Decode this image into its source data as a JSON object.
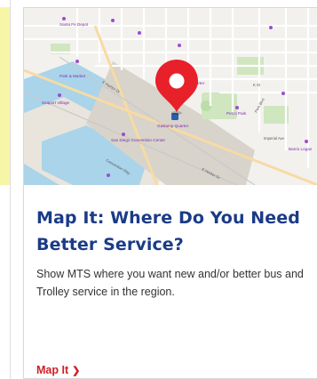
{
  "card": {
    "title": "Map It: Where Do You Need Better Service?",
    "description": "Show MTS where you want new and/or better bus and Trolley service in the region.",
    "cta_label": "Map It",
    "cta_chevron": "❯"
  },
  "map": {
    "street_labels": [
      "E Harbor Dr",
      "Imperial Ave",
      "K St",
      "Park Blvd",
      "Convention Way",
      "E Harbor Dr"
    ],
    "place_labels": [
      "San Diego Convention Center",
      "Petco Park",
      "Gaslamp Quarter",
      "Seaport Village",
      "Park & Market",
      "Barrio Logan",
      "Santa Fe Depot"
    ],
    "station_label": "Gaslamp Quarter",
    "pin_icon": "map-pin-icon"
  },
  "colors": {
    "title": "#1b3b87",
    "cta": "#cc2229",
    "pin": "#e8202a",
    "water": "#a9d4ea",
    "land": "#f3f1ee",
    "park": "#cfe6bf",
    "left_panel": "#f6f6a6"
  }
}
